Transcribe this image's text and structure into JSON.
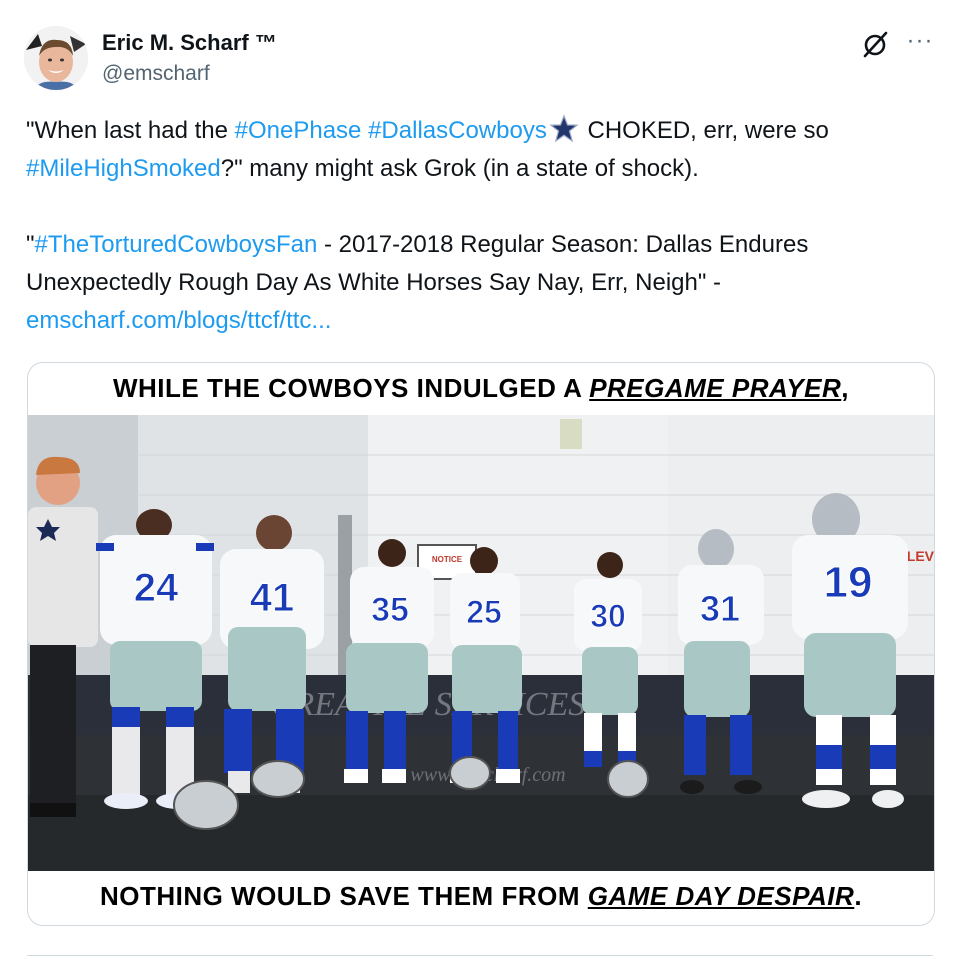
{
  "author": {
    "name": "Eric M. Scharf ™",
    "handle": "@emscharf"
  },
  "icons": {
    "grok": "grok-slash-icon",
    "more": "more-options-icon",
    "star": "dallas-star-emoji"
  },
  "tweet": {
    "p1_a": "\"When last had the ",
    "p1_hash1": "#OnePhase",
    "p1_sp1": " ",
    "p1_hash2": "#DallasCowboys",
    "p1_b": " CHOKED, err, were so ",
    "p1_hash3": "#MileHighSmoked",
    "p1_c": "?\" many might ask Grok (in a state of shock).",
    "p2_a": "\"",
    "p2_hash": "#TheTorturedCowboysFan",
    "p2_b": " - 2017-2018 Regular Season: Dallas Endures Unexpectedly Rough Day As White Horses Say Nay, Err, Neigh\" -",
    "p2_link": "emscharf.com/blogs/ttcf/ttc..."
  },
  "card": {
    "top_prefix": "WHILE THE COWBOYS INDULGED A ",
    "top_em": "PREGAME PRAYER",
    "top_suffix": ",",
    "bottom_prefix": "NOTHING WOULD SAVE THEM FROM ",
    "bottom_em": "GAME DAY DESPAIR",
    "bottom_suffix": ".",
    "jersey_numbers": [
      "24",
      "41",
      "35",
      "25",
      "30",
      "31",
      "19"
    ],
    "sign_text": "NOTICE",
    "wall_text": "LEV",
    "watermark_main": "CREATIVE SERVICES",
    "watermark_url": "www.emscharf.com"
  },
  "colors": {
    "link": "#1d9bf0",
    "text": "#0f1419",
    "secondary": "#536471",
    "cowboys_blue": "#1a3bb8",
    "pants_silver": "#a9c7c4"
  }
}
